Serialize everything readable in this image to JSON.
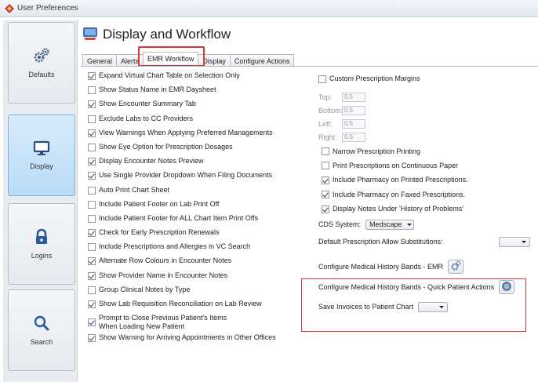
{
  "window": {
    "title": "User Preferences"
  },
  "sidebar": {
    "items": [
      {
        "label": "Defaults",
        "icon": "gear-cluster-icon"
      },
      {
        "label": "Display",
        "icon": "monitor-icon",
        "active": true
      },
      {
        "label": "Logins",
        "icon": "padlock-icon"
      },
      {
        "label": "Search",
        "icon": "magnifier-icon"
      }
    ]
  },
  "header": {
    "title": "Display and Workflow"
  },
  "tabs": [
    {
      "label": "General"
    },
    {
      "label": "Alerts"
    },
    {
      "label": "EMR Workflow",
      "active": true
    },
    {
      "label": "Display"
    },
    {
      "label": "Configure Actions"
    }
  ],
  "workflow_options": [
    {
      "label": "Expand Virtual Chart Table on Selection Only",
      "checked": true
    },
    {
      "label": "Show Status Name in EMR Daysheet",
      "checked": false
    },
    {
      "label": "Show Encounter Summary Tab",
      "checked": true
    },
    {
      "label": "Exclude Labs to CC Providers",
      "checked": false
    },
    {
      "label": "View Warnings When Applying Preferred Managements",
      "checked": true
    },
    {
      "label": "Show Eye Option for Prescription Dosages",
      "checked": false
    },
    {
      "label": "Display Encounter Notes Preview",
      "checked": true
    },
    {
      "label": "Use Single Provider Dropdown When Filing Documents",
      "checked": true
    },
    {
      "label": "Auto Print Chart Sheet",
      "checked": false
    },
    {
      "label": "Include Patient Footer on Lab Print Off",
      "checked": false
    },
    {
      "label": "Include Patient Footer for ALL Chart Item Print Offs",
      "checked": false
    },
    {
      "label": "Check for Early Prescription Renewals",
      "checked": true
    },
    {
      "label": "Include Prescriptions and Allergies in VC Search",
      "checked": false
    },
    {
      "label": "Alternate Row Colours in Encounter Notes",
      "checked": true
    },
    {
      "label": "Show Provider Name in Encounter Notes",
      "checked": true
    },
    {
      "label": "Group Clinical Notes by Type",
      "checked": false
    },
    {
      "label": "Show Lab Requisition Reconciliation on Lab Review",
      "checked": true
    },
    {
      "label": "Prompt to Close Previous Patient's Items",
      "label2": "When Loading New Patient",
      "checked": true
    },
    {
      "label": "Show Warning for Arriving Appointments in Other Offices",
      "checked": true
    }
  ],
  "prescription": {
    "custom_margins_label": "Custom Prescription Margins",
    "custom_margins_checked": false,
    "margins": [
      {
        "label": "Top:",
        "value": "0.5"
      },
      {
        "label": "Bottom:",
        "value": "0.5"
      },
      {
        "label": "Left:",
        "value": "0.5"
      },
      {
        "label": "Right:",
        "value": "0.5"
      }
    ],
    "options": [
      {
        "label": "Narrow Prescription Printing",
        "checked": false
      },
      {
        "label": "Print Prescriptions on Continuous Paper",
        "checked": false
      },
      {
        "label": "Include Pharmacy on Printed Prescriptions.",
        "checked": true
      },
      {
        "label": "Include Pharmacy on Faxed Prescriptions.",
        "checked": true
      },
      {
        "label": "Display Notes Under 'History of Problems'",
        "checked": true
      }
    ],
    "cds_label": "CDS System:",
    "cds_value": "Medscape",
    "substitutions_label": "Default Prescription Allow Substitutions:",
    "substitutions_value": ""
  },
  "medical_history": {
    "emr_label": "Configure Medical History Bands - EMR",
    "quick_label": "Configure Medical History Bands - Quick Patient Actions"
  },
  "invoices": {
    "label": "Save Invoices to Patient Chart",
    "value": ""
  },
  "colors": {
    "highlight": "#d9363a",
    "active_nav": "#b8dbf5"
  }
}
